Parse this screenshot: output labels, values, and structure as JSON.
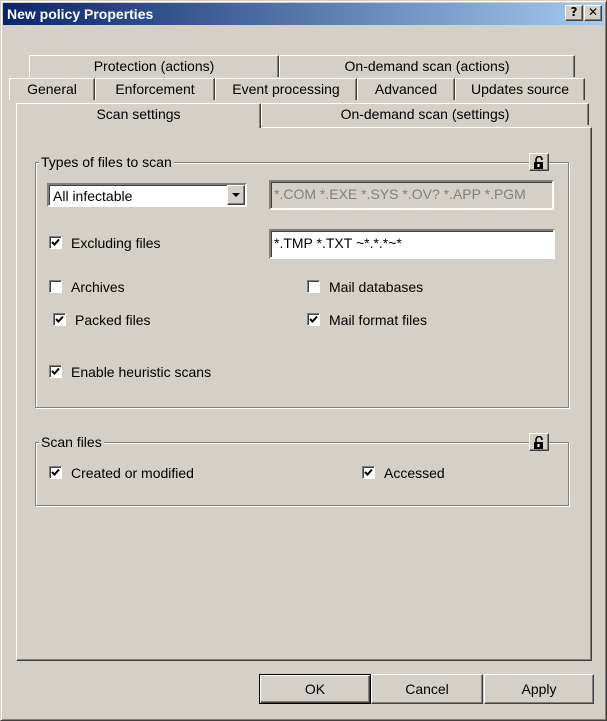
{
  "window": {
    "title": "New policy Properties",
    "help_label": "?",
    "close_label": "✕"
  },
  "tabs": {
    "row1": [
      "Protection (actions)",
      "On-demand scan (actions)"
    ],
    "row2": [
      "General",
      "Enforcement",
      "Event processing",
      "Advanced",
      "Updates source"
    ],
    "row3": [
      "Scan settings",
      "On-demand scan (settings)"
    ],
    "active": "Scan settings"
  },
  "types_group": {
    "title": "Types of files to scan",
    "file_type_select": "All infectable",
    "extensions": "*.COM *.EXE *.SYS *.OV? *.APP *.PGM",
    "excluding": {
      "label": "Excluding files",
      "checked": true
    },
    "exclusions": "*.TMP *.TXT ~*.*.*~*",
    "archives": {
      "label": "Archives",
      "checked": false
    },
    "mail_databases": {
      "label": "Mail databases",
      "checked": false
    },
    "packed_files": {
      "label": "Packed files",
      "checked": true
    },
    "mail_format_files": {
      "label": "Mail format files",
      "checked": true
    },
    "heuristic": {
      "label": "Enable heuristic scans",
      "checked": true
    }
  },
  "scan_files_group": {
    "title": "Scan files",
    "created_modified": {
      "label": "Created or modified",
      "checked": true
    },
    "accessed": {
      "label": "Accessed",
      "checked": true
    }
  },
  "buttons": {
    "ok": "OK",
    "cancel": "Cancel",
    "apply": "Apply"
  },
  "icons": {
    "lock": "padlock-icon",
    "check": "checkmark-icon",
    "dropdown": "dropdown-arrow-icon"
  }
}
